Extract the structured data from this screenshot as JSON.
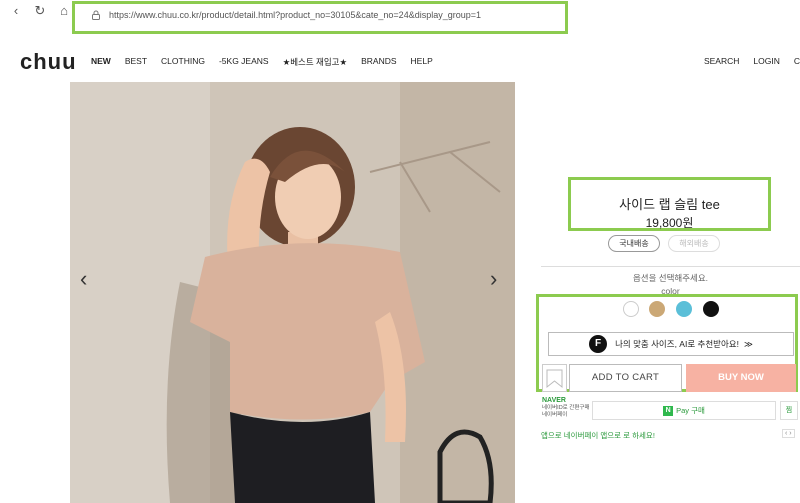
{
  "browser": {
    "url": "https://www.chuu.co.kr/product/detail.html?product_no=30105&cate_no=24&display_group=1"
  },
  "header": {
    "logo": "chuu",
    "nav": [
      "NEW",
      "BEST",
      "CLOTHING",
      "-5KG JEANS",
      "★베스트 재입고★",
      "BRANDS",
      "HELP"
    ],
    "util": [
      "SEARCH",
      "LOGIN",
      "C"
    ]
  },
  "product": {
    "name": "사이드 랩 슬림 tee",
    "price": "19,800원",
    "shipping_domestic": "국내배송",
    "shipping_overseas": "해외배송",
    "select_hint": "옵션을 선택해주세요.",
    "color_label": "color",
    "colors": [
      "#ffffff",
      "#cba876",
      "#5bbfd8",
      "#111111"
    ],
    "ai_logo": "F",
    "ai_size_label": "나의 맞춤 사이즈, AI로 추천받아요!",
    "ai_arrow": "≫",
    "add_to_cart": "ADD TO CART",
    "buy_now": "BUY NOW"
  },
  "naver": {
    "label": "NAVER",
    "desc": "네이버ID로 간편구매 네이버페이",
    "pay_mark": "N",
    "pay_label": "Pay 구매",
    "wish": "찜",
    "note": "앱으로 네이버페이 앱으로 로 하세요!",
    "note_arrows": "‹ ›"
  },
  "colors": {
    "highlight": "#8ccb4f",
    "buy_now_bg": "#f7b2a3",
    "naver_green": "#2b9a3c"
  }
}
